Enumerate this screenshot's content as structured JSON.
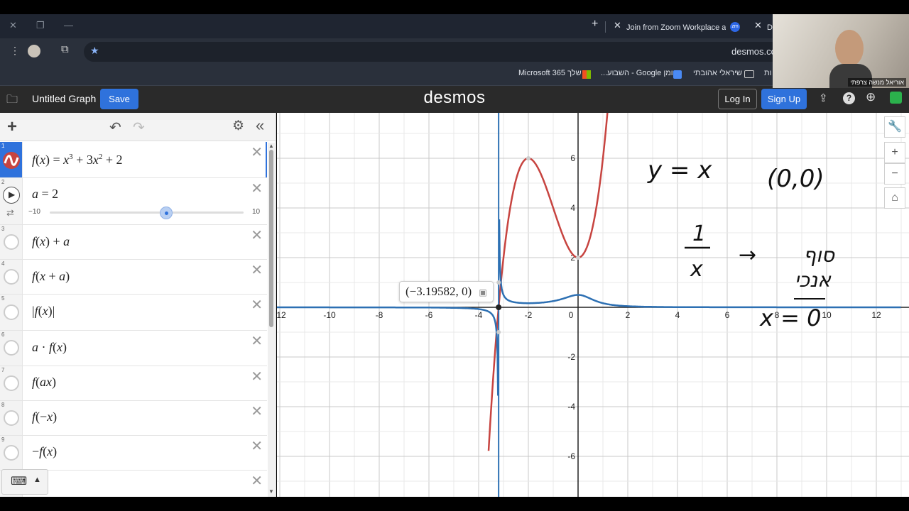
{
  "browser": {
    "tabs": [
      {
        "title": "Join from Zoom Workplace app"
      },
      {
        "title": "De"
      }
    ],
    "url": "desmos.com",
    "bookmarks": [
      "שלך Microsoft 365",
      "יומן Google - השבוע...",
      "שיראלי אהובתי",
      "ות"
    ]
  },
  "header": {
    "graph_title": "Untitled Graph",
    "save_label": "Save",
    "logo": "desmos",
    "login_label": "Log In",
    "signup_label": "Sign Up"
  },
  "expressions": [
    {
      "num": "1",
      "latex": "f(x)=x^3+3x^2+2",
      "color": "#c74440"
    },
    {
      "num": "2",
      "latex": "a=2",
      "slider_min": "−10",
      "slider_max": "10",
      "value": 2
    },
    {
      "num": "3",
      "latex": "f(x)+a"
    },
    {
      "num": "4",
      "latex": "f(x+a)"
    },
    {
      "num": "5",
      "latex": "|f(x)|"
    },
    {
      "num": "6",
      "latex": "a·f(x)"
    },
    {
      "num": "7",
      "latex": "f(ax)"
    },
    {
      "num": "8",
      "latex": "f(−x)"
    },
    {
      "num": "9",
      "latex": "−f(x)"
    }
  ],
  "graph": {
    "x_ticks": [
      "-12",
      "-10",
      "-8",
      "-6",
      "-4",
      "-2",
      "0",
      "2",
      "4",
      "6",
      "8",
      "10",
      "12"
    ],
    "y_ticks": [
      "6",
      "4",
      "2",
      "-2",
      "-4",
      "-6"
    ],
    "coordinate_tooltip": "(−3.19582, 0)",
    "curve1_color": "#c74440",
    "curve2_color": "#2d70b3",
    "handwriting": {
      "line1": "y = x",
      "line1b": "(0,0)",
      "fraction": "1/x",
      "hebrew1": "סוף",
      "hebrew2": "אנכי",
      "vertical": "x = 0"
    }
  },
  "webcam": {
    "name": "אוריאל מנשה צרפתי"
  }
}
